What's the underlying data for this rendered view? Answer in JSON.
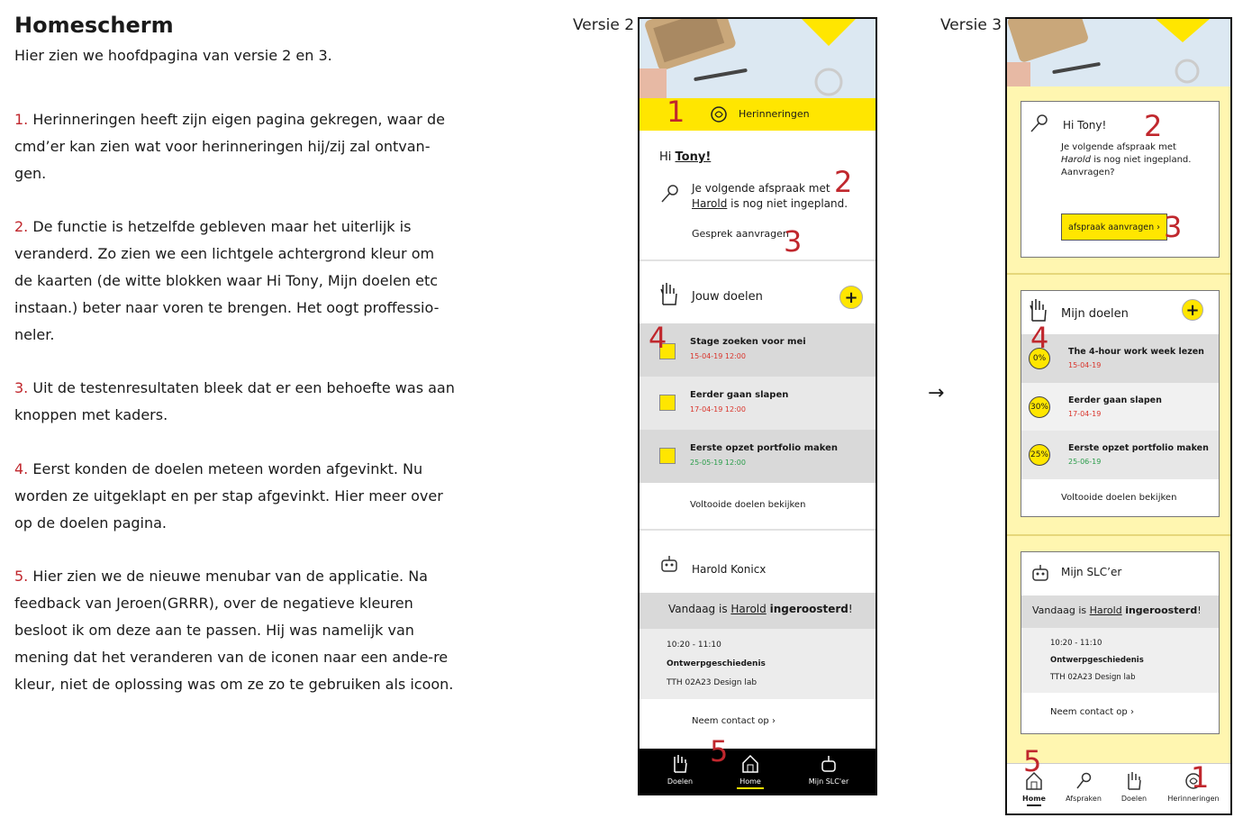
{
  "doc": {
    "title": "Homescherm",
    "intro": "Hier zien we hoofdpagina van versie 2 en 3.",
    "points": [
      {
        "n": "1.",
        "text": "Herinneringen heeft zijn eigen pagina gekregen, waar de cmd’er kan zien wat voor herinneringen hij/zij zal ontvan-gen."
      },
      {
        "n": "2.",
        "text": "De functie is hetzelfde gebleven maar het uiterlijk is veranderd. Zo zien we een lichtgele achtergrond kleur om de kaarten (de witte blokken waar Hi Tony, Mijn doelen etc instaan.) beter naar voren te brengen. Het oogt proffessio-neler."
      },
      {
        "n": "3.",
        "text": "Uit de testenresultaten bleek dat er een behoefte was aan knoppen met kaders."
      },
      {
        "n": "4.",
        "text": "Eerst konden de doelen meteen worden afgevinkt. Nu worden ze uitgeklapt en per stap afgevinkt. Hier meer over op de doelen pagina."
      },
      {
        "n": "5.",
        "text": "Hier zien we de nieuwe menubar van de applicatie. Na feedback van Jeroen(GRRR), over de negatieve kleuren besloot ik om deze aan te passen. Hij was namelijk van mening dat het veranderen van de iconen naar een ande-re kleur, niet de oplossing was om ze zo te gebruiken als icoon."
      }
    ]
  },
  "v2": {
    "label": "Versie 2",
    "banner": "Herinneringen",
    "greeting_prefix": "Hi ",
    "greeting_name": "Tony!",
    "appt_line1": "Je volgende afspraak met",
    "appt_name": "Harold",
    "appt_line2": " is nog niet ingepland.",
    "request": "Gesprek aanvragen",
    "goals_title": "Jouw doelen",
    "goals": [
      {
        "title": "Stage zoeken voor mei",
        "date": "15-04-19 12:00",
        "date_color": "#d9342b"
      },
      {
        "title": "Eerder gaan slapen",
        "date": "17-04-19 12:00",
        "date_color": "#d9342b"
      },
      {
        "title": "Eerste opzet portfolio maken",
        "date": "25-05-19 12:00",
        "date_color": "#2a9d4a"
      }
    ],
    "completed": "Voltooide doelen bekijken",
    "slc_name": "Harold Konicx",
    "sched_prefix": "Vandaag is ",
    "sched_name": "Harold",
    "sched_bold": "ingeroosterd",
    "sched_suffix": "!",
    "time": "10:20 - 11:10",
    "course": "Ontwerpgeschiedenis",
    "room": "TTH 02A23 Design lab",
    "contact": "Neem contact op",
    "nav": [
      "Doelen",
      "Home",
      "Mijn SLC'er"
    ]
  },
  "v3": {
    "label": "Versie 3",
    "greeting": "Hi Tony!",
    "appt_line1": "Je volgende afspraak met",
    "appt_name": "Harold",
    "appt_line2": " is nog niet ingepland.",
    "appt_line3": "Aanvragen?",
    "request_button": "afspraak aanvragen",
    "goals_title": "Mijn doelen",
    "goals": [
      {
        "pct": "0%",
        "title": "The 4-hour work week lezen",
        "date": "15-04-19",
        "date_color": "#d9342b"
      },
      {
        "pct": "30%",
        "title": "Eerder gaan slapen",
        "date": "17-04-19",
        "date_color": "#d9342b"
      },
      {
        "pct": "25%",
        "title": "Eerste opzet portfolio maken",
        "date": "25-06-19",
        "date_color": "#2a9d4a"
      }
    ],
    "completed": "Voltooide doelen bekijken",
    "slc_title": "Mijn SLC’er",
    "sched_prefix": "Vandaag is ",
    "sched_name": "Harold",
    "sched_bold": "ingeroosterd",
    "sched_suffix": "!",
    "time": "10:20 - 11:10",
    "course": "Ontwerpgeschiedenis",
    "room": "TTH 02A23 Design lab",
    "contact": "Neem contact op",
    "nav": [
      "Home",
      "Afspraken",
      "Doelen",
      "Herinneringen"
    ]
  },
  "markers": {
    "m1": "1",
    "m2": "2",
    "m3": "3",
    "m4": "4",
    "m5": "5"
  },
  "arrow": "→",
  "colors": {
    "accent_yellow": "#ffe600",
    "marker_red": "#c0272d",
    "v3_bg": "#fff6b0"
  }
}
